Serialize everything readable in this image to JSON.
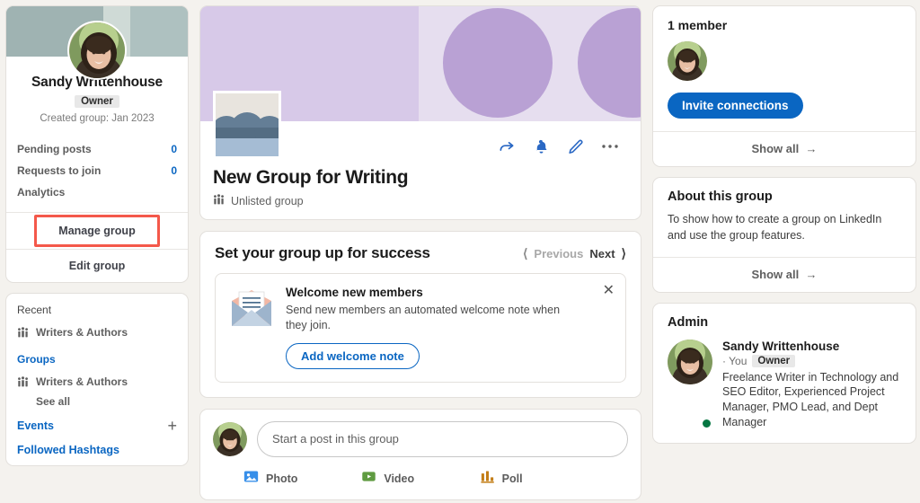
{
  "left_sidebar": {
    "profile": {
      "name": "Sandy Writtenhouse",
      "badge": "Owner",
      "created": "Created group: Jan 2023"
    },
    "stats": [
      {
        "label": "Pending posts",
        "value": "0"
      },
      {
        "label": "Requests to join",
        "value": "0"
      },
      {
        "label": "Analytics",
        "value": ""
      }
    ],
    "manage_group": "Manage group",
    "edit_group": "Edit group",
    "recent_label": "Recent",
    "recent_items": [
      {
        "label": "Writers & Authors",
        "icon": "group-icon"
      }
    ],
    "groups_label": "Groups",
    "groups_items": [
      {
        "label": "Writers & Authors",
        "icon": "group-icon"
      }
    ],
    "groups_see_all": "See all",
    "events_label": "Events",
    "events_add_icon": "plus-icon",
    "hashtags_label": "Followed Hashtags"
  },
  "group_header": {
    "title": "New Group for Writing",
    "privacy": "Unlisted group",
    "privacy_icon": "group-icon",
    "actions": [
      {
        "name": "share-icon"
      },
      {
        "name": "bell-icon"
      },
      {
        "name": "pencil-icon"
      },
      {
        "name": "more-options-icon"
      }
    ]
  },
  "success_section": {
    "title": "Set your group up for success",
    "previous": "Previous",
    "next": "Next",
    "card": {
      "icon": "envelope-icon",
      "title": "Welcome new members",
      "description": "Send new members an automated welcome note when they join.",
      "button": "Add welcome note",
      "close_icon": "close-icon"
    }
  },
  "composer": {
    "placeholder": "Start a post in this group",
    "actions": [
      {
        "label": "Photo",
        "icon": "photo-icon",
        "color": "#378fe9"
      },
      {
        "label": "Video",
        "icon": "video-icon",
        "color": "#5f9b41"
      },
      {
        "label": "Poll",
        "icon": "poll-icon",
        "color": "#c37d16"
      }
    ]
  },
  "members_card": {
    "count": "1 member",
    "invite_button": "Invite connections",
    "show_all": "Show all"
  },
  "about_card": {
    "title": "About this group",
    "text": "To show how to create a group on LinkedIn and use the group features.",
    "show_all": "Show all"
  },
  "admin_card": {
    "title": "Admin",
    "name": "Sandy Writtenhouse",
    "you": "· You",
    "badge": "Owner",
    "description": "Freelance Writer in Technology and SEO Editor, Experienced Project Manager, PMO Lead, and Dept Manager"
  },
  "colors": {
    "accent": "#0a66c2",
    "page_bg": "#f4f2ee",
    "highlight": "#f4584a",
    "online": "#057642",
    "banner_left": "#d7c9e8",
    "banner_right": "#e6deef",
    "banner_circle": "#b9a1d4"
  }
}
